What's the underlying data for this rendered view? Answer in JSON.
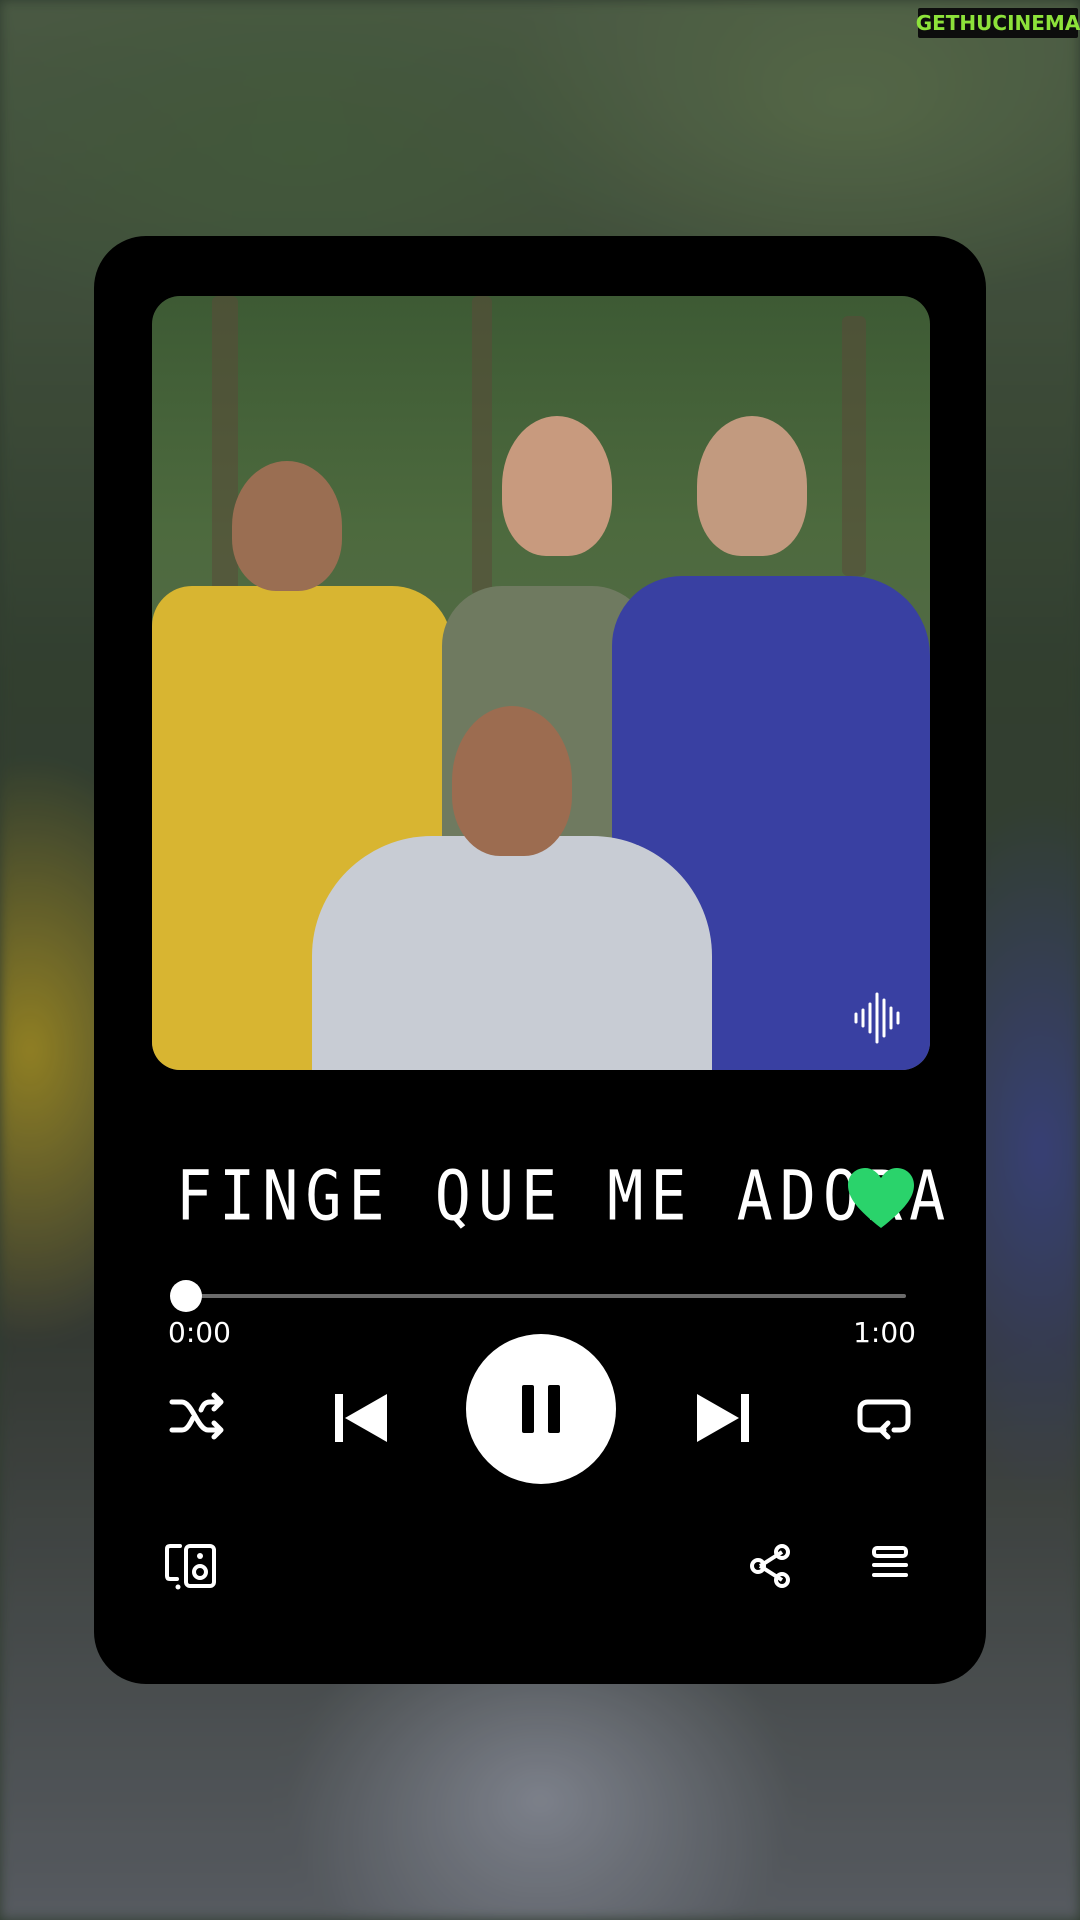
{
  "watermark": {
    "part1": "GETHU",
    "part2": "CINEMA"
  },
  "track": {
    "title": "FINGE QUE ME ADORA",
    "liked": true,
    "elapsed": "0:00",
    "duration": "1:00",
    "progress_fraction": 0.0
  },
  "icons": {
    "like": "heart-icon",
    "shuffle": "shuffle-icon",
    "previous": "skip-previous-icon",
    "play_pause": "pause-icon",
    "next": "skip-next-icon",
    "repeat": "repeat-icon",
    "devices": "connect-device-icon",
    "share": "share-icon",
    "queue": "queue-icon",
    "audio": "sound-wave-icon"
  },
  "colors": {
    "accent": "#2ad36b",
    "card": "#000000",
    "watermark_text": "#8de23a"
  }
}
